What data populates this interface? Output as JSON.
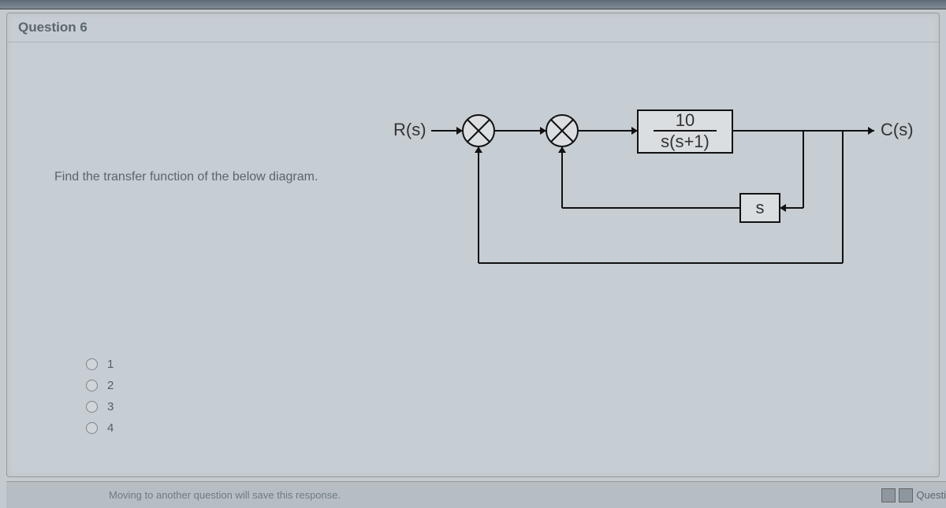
{
  "header": {
    "title": "Question 6"
  },
  "prompt": "Find the transfer function of the below diagram.",
  "diagram": {
    "input_label": "R(s)",
    "output_label": "C(s)",
    "forward_block": {
      "num": "10",
      "den": "s(s+1)"
    },
    "feedback_block": "s"
  },
  "options": [
    "1",
    "2",
    "3",
    "4"
  ],
  "footer": {
    "save_msg": "Moving to another question will save this response.",
    "nav_label": "Questi"
  }
}
